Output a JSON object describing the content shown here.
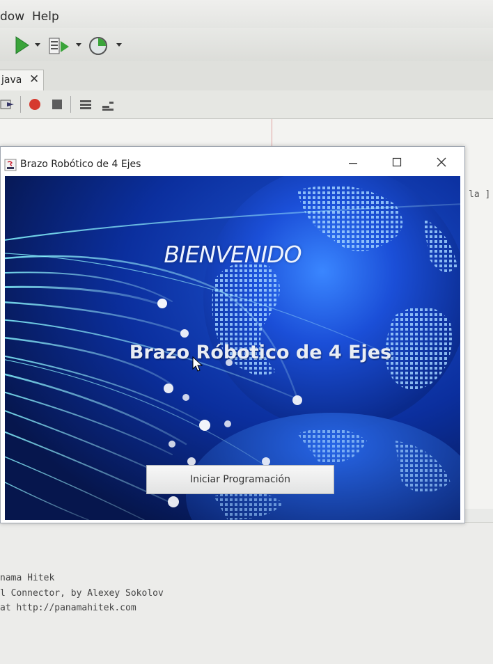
{
  "ide": {
    "menu": [
      "dow",
      "Help"
    ],
    "tab": {
      "label": "java",
      "close": "✕"
    },
    "side_text": "la ]",
    "output_lines": [
      "nama Hitek",
      "l Connector, by Alexey Sokolov",
      "at http://panamahitek.com"
    ]
  },
  "window": {
    "title": "Brazo Robótico de 4 Ejes",
    "minimize": "—",
    "maximize": "☐",
    "close": "✕"
  },
  "content": {
    "welcome": "BIENVENIDO",
    "subtitle": "Brazo Róbotico de 4 Ejes",
    "start_button": "Iniciar Programación"
  },
  "colors": {
    "run_green": "#3aa43a",
    "record_red": "#d63a2e",
    "globe_blue": "#1c4fd6"
  }
}
